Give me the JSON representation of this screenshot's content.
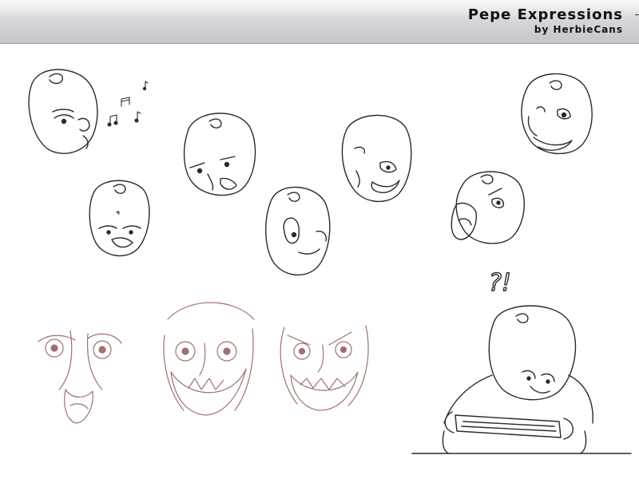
{
  "header": {
    "title": "Pepe Expressions",
    "byline": "by HerbieCans"
  },
  "art": {
    "doodle_text": "?!"
  },
  "colors": {
    "ink": "#2a2a2a",
    "sketch": "#a07070",
    "header_top": "#e9e9eb",
    "header_bottom": "#c4c4c9"
  }
}
